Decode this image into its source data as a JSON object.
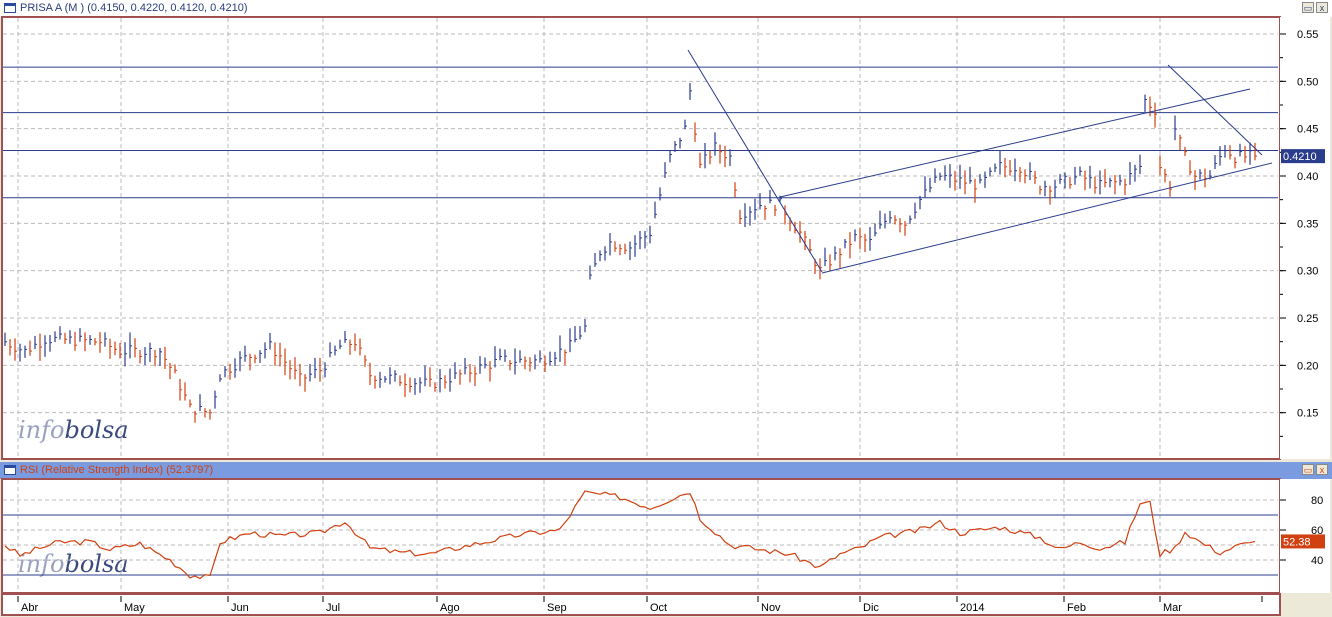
{
  "price_panel": {
    "title": "PRISA A (M ) (0.4150, 0.4220, 0.4120, 0.4210)",
    "last_label": "0.4210"
  },
  "rsi_panel": {
    "title": "RSI (Relative Strength Index) (52.3797)",
    "last_label": "52.38"
  },
  "watermark": {
    "a": "info",
    "b": "bolsa"
  },
  "buttons": {
    "max": "▭",
    "close": "x"
  },
  "colors": {
    "up": "#2a3c8c",
    "down": "#d04010",
    "hline": "#2a3c8c"
  },
  "chart_data": [
    {
      "type": "ohlc",
      "title": "PRISA A (M )",
      "ylim": [
        0.11,
        0.57
      ],
      "yticks": [
        "0.55",
        "0.50",
        "0.45",
        "0.40",
        "0.35",
        "0.30",
        "0.25",
        "0.20",
        "0.15"
      ],
      "ytick_values": [
        0.55,
        0.5,
        0.45,
        0.4,
        0.35,
        0.3,
        0.25,
        0.2,
        0.15
      ],
      "x_labels": [
        "Abr",
        "May",
        "Jun",
        "Jul",
        "Ago",
        "Sep",
        "Oct",
        "Nov",
        "Dic",
        "2014",
        "Feb",
        "Mar"
      ],
      "close_keypoints_by_day": [
        [
          0,
          0.225
        ],
        [
          4,
          0.215
        ],
        [
          8,
          0.228
        ],
        [
          19,
          0.225
        ],
        [
          23,
          0.215
        ],
        [
          31,
          0.215
        ],
        [
          34,
          0.19
        ],
        [
          37,
          0.155
        ],
        [
          41,
          0.15
        ],
        [
          43,
          0.19
        ],
        [
          47,
          0.205
        ],
        [
          53,
          0.22
        ],
        [
          55,
          0.21
        ],
        [
          59,
          0.185
        ],
        [
          63,
          0.195
        ],
        [
          67,
          0.22
        ],
        [
          70,
          0.225
        ],
        [
          73,
          0.19
        ],
        [
          79,
          0.185
        ],
        [
          85,
          0.18
        ],
        [
          91,
          0.19
        ],
        [
          99,
          0.205
        ],
        [
          107,
          0.205
        ],
        [
          113,
          0.22
        ],
        [
          116,
          0.24
        ],
        [
          117,
          0.29
        ],
        [
          119,
          0.32
        ],
        [
          121,
          0.33
        ],
        [
          125,
          0.325
        ],
        [
          129,
          0.34
        ],
        [
          131,
          0.38
        ],
        [
          133,
          0.42
        ],
        [
          136,
          0.45
        ],
        [
          137,
          0.49
        ],
        [
          139,
          0.41
        ],
        [
          142,
          0.43
        ],
        [
          145,
          0.42
        ],
        [
          147,
          0.36
        ],
        [
          151,
          0.37
        ],
        [
          155,
          0.37
        ],
        [
          159,
          0.34
        ],
        [
          163,
          0.3
        ],
        [
          167,
          0.32
        ],
        [
          170,
          0.335
        ],
        [
          173,
          0.33
        ],
        [
          177,
          0.36
        ],
        [
          180,
          0.35
        ],
        [
          183,
          0.375
        ],
        [
          187,
          0.4
        ],
        [
          191,
          0.395
        ],
        [
          195,
          0.39
        ],
        [
          199,
          0.41
        ],
        [
          203,
          0.41
        ],
        [
          207,
          0.39
        ],
        [
          210,
          0.39
        ],
        [
          215,
          0.4
        ],
        [
          219,
          0.39
        ],
        [
          224,
          0.395
        ],
        [
          227,
          0.41
        ],
        [
          228,
          0.48
        ],
        [
          230,
          0.47
        ],
        [
          231,
          0.41
        ],
        [
          233,
          0.39
        ],
        [
          234,
          0.45
        ],
        [
          236,
          0.42
        ],
        [
          238,
          0.4
        ],
        [
          241,
          0.4
        ],
        [
          244,
          0.43
        ],
        [
          246,
          0.42
        ],
        [
          250,
          0.421
        ]
      ],
      "horizontal_lines": [
        0.515,
        0.467,
        0.427,
        0.377
      ],
      "last": 0.421
    },
    {
      "type": "line",
      "title": "RSI (Relative Strength Index)",
      "ylim": [
        25,
        92
      ],
      "yticks": [
        "80",
        "60",
        "40"
      ],
      "ytick_values": [
        80,
        60,
        40
      ],
      "levels": [
        70,
        30
      ],
      "keypoints_by_day": [
        [
          0,
          50
        ],
        [
          3,
          43
        ],
        [
          7,
          48
        ],
        [
          11,
          52
        ],
        [
          17,
          52
        ],
        [
          21,
          47
        ],
        [
          27,
          51
        ],
        [
          33,
          40
        ],
        [
          37,
          30
        ],
        [
          41,
          28
        ],
        [
          43,
          52
        ],
        [
          49,
          58
        ],
        [
          55,
          56
        ],
        [
          63,
          58
        ],
        [
          68,
          66
        ],
        [
          73,
          48
        ],
        [
          79,
          45
        ],
        [
          85,
          44
        ],
        [
          93,
          50
        ],
        [
          103,
          57
        ],
        [
          111,
          60
        ],
        [
          116,
          85
        ],
        [
          123,
          82
        ],
        [
          129,
          75
        ],
        [
          137,
          86
        ],
        [
          139,
          68
        ],
        [
          145,
          50
        ],
        [
          151,
          47
        ],
        [
          157,
          44
        ],
        [
          163,
          35
        ],
        [
          167,
          44
        ],
        [
          171,
          48
        ],
        [
          175,
          55
        ],
        [
          183,
          60
        ],
        [
          187,
          65
        ],
        [
          191,
          58
        ],
        [
          199,
          62
        ],
        [
          207,
          55
        ],
        [
          211,
          47
        ],
        [
          215,
          52
        ],
        [
          219,
          48
        ],
        [
          224,
          52
        ],
        [
          227,
          78
        ],
        [
          229,
          78
        ],
        [
          231,
          44
        ],
        [
          234,
          48
        ],
        [
          236,
          59
        ],
        [
          239,
          52
        ],
        [
          243,
          45
        ],
        [
          247,
          50
        ],
        [
          249,
          51
        ],
        [
          250,
          52.38
        ]
      ],
      "last": 52.38
    }
  ]
}
